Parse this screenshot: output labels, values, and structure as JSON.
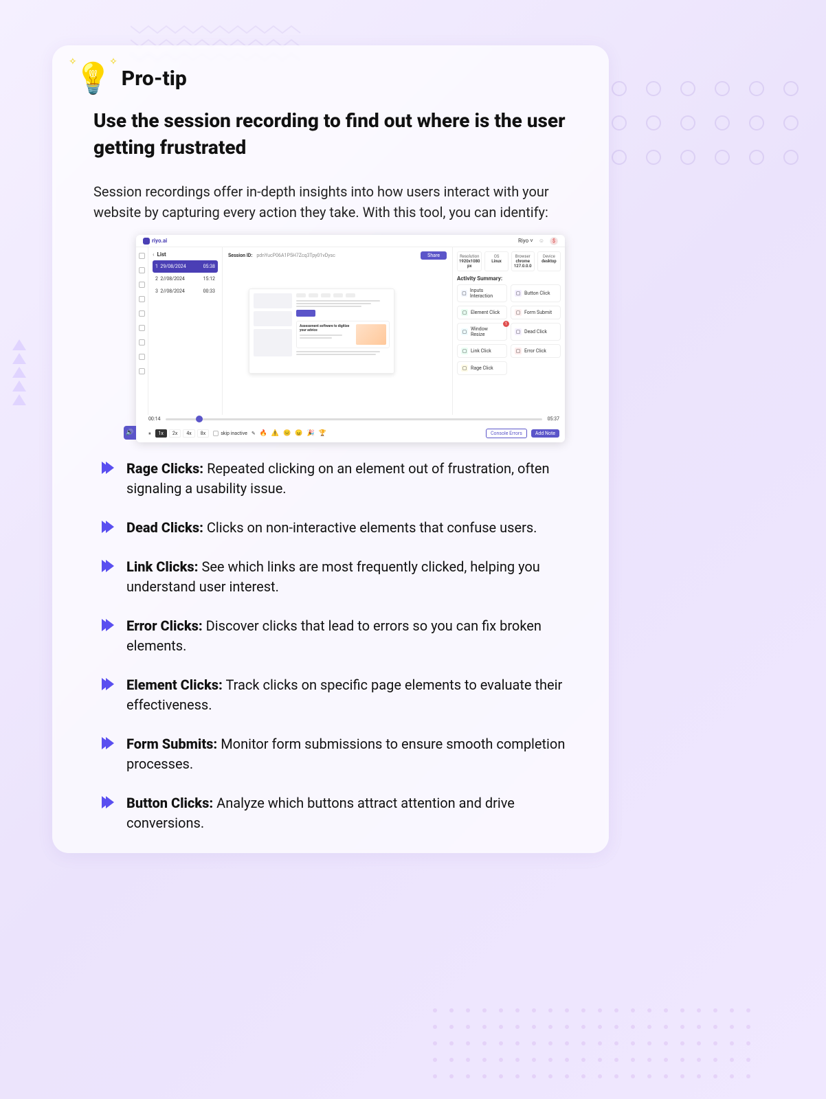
{
  "header": {
    "pro_tip": "Pro-tip"
  },
  "hero": "Use the session recording to find out where is the user getting frustrated",
  "intro": "Session recordings offer in-depth insights into how users interact with your website by capturing every action they take. With this tool, you can identify:",
  "shot": {
    "brand": "riyo.ai",
    "account": "Riyo",
    "avatar_initial": "$",
    "list_title": "List",
    "rows": [
      {
        "idx": "1",
        "date": "29/08/2024",
        "dur": "05:38"
      },
      {
        "idx": "2",
        "date": "2//08/2024",
        "dur": "15:12"
      },
      {
        "idx": "3",
        "date": "2//08/2024",
        "dur": "00:33"
      }
    ],
    "session_id_label": "Session ID:",
    "session_id": "pdnYucP06A1P5H7Zcq3Tpy01vDysc",
    "share": "Share",
    "infocols": [
      {
        "k": "Resolution",
        "v": "1920x1080 px"
      },
      {
        "k": "OS",
        "v": "Linux"
      },
      {
        "k": "Browser",
        "v": "chrome 127.0.0.0"
      },
      {
        "k": "Device",
        "v": "desktop"
      }
    ],
    "activity_title": "Activity Summary:",
    "activities": [
      {
        "name": "Inputs Interaction",
        "color": "#f2f6ff"
      },
      {
        "name": "Button Click",
        "color": "#f3eeff"
      },
      {
        "name": "Element Click",
        "color": "#e8fff2"
      },
      {
        "name": "Form Submit",
        "color": "#fff0f0"
      },
      {
        "name": "Window Resize",
        "color": "#eefcff",
        "badge": "1"
      },
      {
        "name": "Dead Click",
        "color": "#f5f0ff"
      },
      {
        "name": "Link Click",
        "color": "#eafff4"
      },
      {
        "name": "Error Click",
        "color": "#ffecec"
      },
      {
        "name": "Rage Click",
        "color": "#fffbe6"
      }
    ],
    "time_current": "00:14",
    "time_total": "05:37",
    "speeds": [
      "1x",
      "2x",
      "4x",
      "8x"
    ],
    "skip": "skip inactive",
    "console": "Console Errors",
    "addnote": "Add Note",
    "preview_title": "Assessment software to digitize your advice"
  },
  "bullets": [
    {
      "title": "Rage Clicks:",
      "desc": " Repeated clicking on an element out of frustration, often signaling a usability issue."
    },
    {
      "title": "Dead Clicks:",
      "desc": " Clicks on non-interactive elements that confuse users."
    },
    {
      "title": "Link Clicks:",
      "desc": " See which links are most frequently clicked, helping you understand user interest."
    },
    {
      "title": "Error Clicks:",
      "desc": " Discover clicks that lead to errors so you can fix broken elements."
    },
    {
      "title": "Element Clicks:",
      "desc": " Track clicks on specific page elements to evaluate their effectiveness."
    },
    {
      "title": "Form Submits:",
      "desc": " Monitor form submissions to ensure smooth completion processes."
    },
    {
      "title": "Button Clicks:",
      "desc": " Analyze which buttons attract attention and drive conversions."
    }
  ]
}
